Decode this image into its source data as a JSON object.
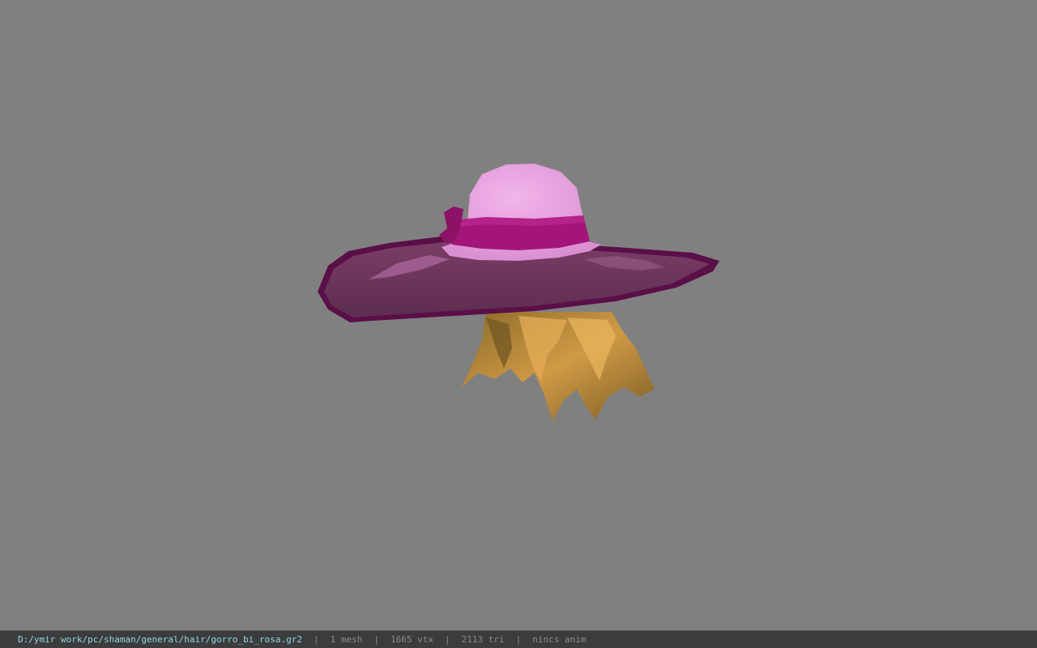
{
  "viewer": {
    "background_color": "#808080",
    "model_icon": "hat-with-hair-model",
    "colors": {
      "brim": "#6b3358",
      "brim_edge": "#5a0f48",
      "crown": "#eaa2e2",
      "band": "#a3157a",
      "hair": "#c58b3a"
    }
  },
  "status": {
    "path": "D:/ymir work/pc/shaman/general/hair/gorro_bi_rosa.gr2",
    "sep": "|",
    "mesh": "1 mesh",
    "vtx": "1665 vtx",
    "tri": "2113 tri",
    "anim": "nincs anim"
  }
}
